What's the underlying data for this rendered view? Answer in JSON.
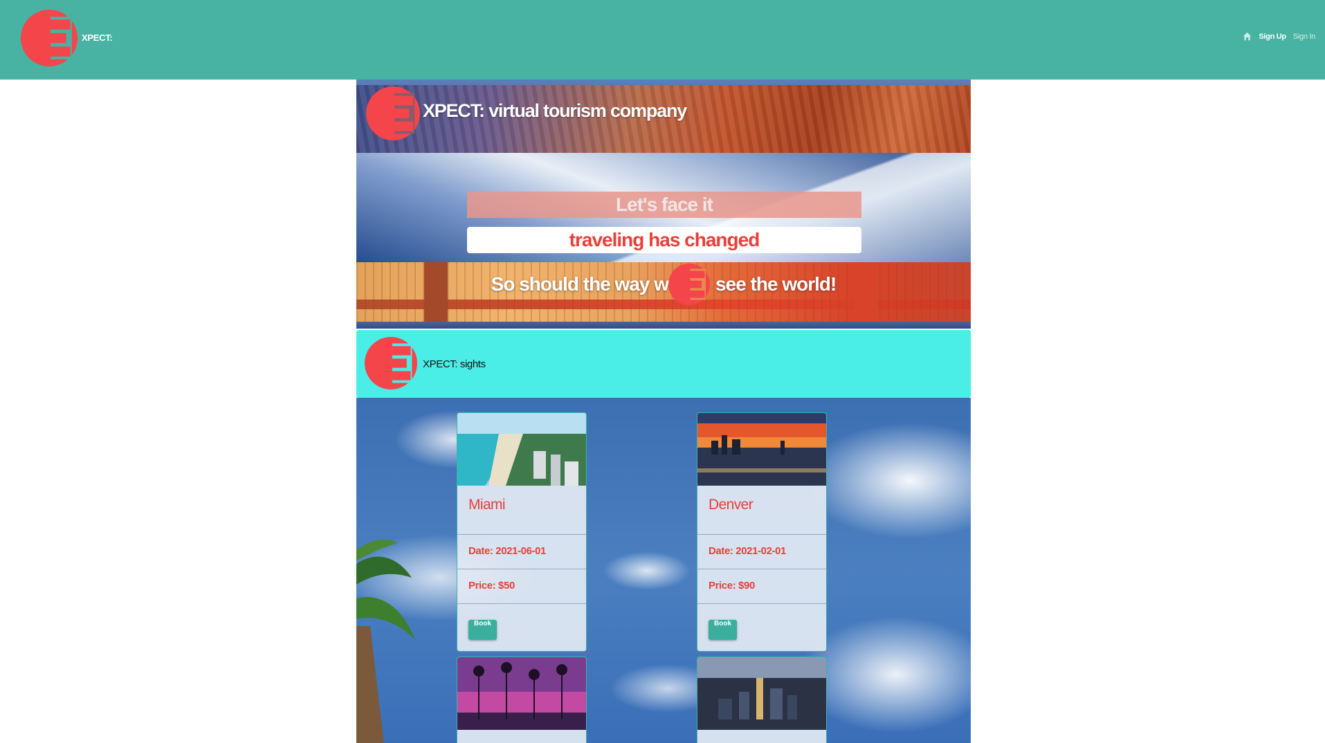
{
  "navbar": {
    "brand": "XPECT:",
    "signup_label": "Sign Up",
    "signin_label": "Sign In"
  },
  "hero": {
    "title": "XPECT: virtual tourism company",
    "tagline_1": "Let's face it",
    "tagline_2": "traveling has changed",
    "slogan_before": "So should the way w",
    "slogan_after": "see the world!"
  },
  "sights": {
    "title": "XPECT: sights"
  },
  "cards": [
    {
      "city": "Miami",
      "date": "Date: 2021-06-01",
      "price": "Price: $50",
      "button": "Book"
    },
    {
      "city": "Denver",
      "date": "Date: 2021-02-01",
      "price": "Price: $90",
      "button": "Book"
    }
  ],
  "colors": {
    "navbar": "#48b3a3",
    "logo_red": "#f4454a",
    "accent_red": "#e8403a",
    "sights_bar": "#4aeee6",
    "button": "#3aaf9d"
  }
}
